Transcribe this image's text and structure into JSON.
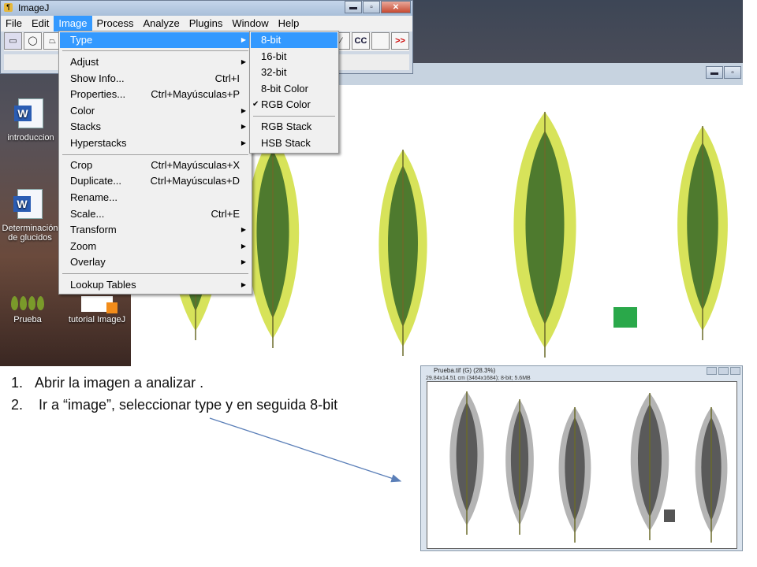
{
  "imagej": {
    "title": "ImageJ",
    "menubar": [
      "File",
      "Edit",
      "Image",
      "Process",
      "Analyze",
      "Plugins",
      "Window",
      "Help"
    ],
    "active_menu": "Image",
    "toolbar": {
      "cc_label": "CC",
      "more_label": ">>"
    }
  },
  "image_menu": {
    "items": [
      {
        "label": "Type",
        "shortcut": "",
        "submenu": true,
        "highlighted": true
      },
      {
        "label": "Adjust",
        "shortcut": "",
        "submenu": true
      },
      {
        "label": "Show Info...",
        "shortcut": "Ctrl+I"
      },
      {
        "label": "Properties...",
        "shortcut": "Ctrl+Mayúsculas+P"
      },
      {
        "label": "Color",
        "shortcut": "",
        "submenu": true
      },
      {
        "label": "Stacks",
        "shortcut": "",
        "submenu": true
      },
      {
        "label": "Hyperstacks",
        "shortcut": "",
        "submenu": true
      },
      {
        "label": "Crop",
        "shortcut": "Ctrl+Mayúsculas+X"
      },
      {
        "label": "Duplicate...",
        "shortcut": "Ctrl+Mayúsculas+D"
      },
      {
        "label": "Rename...",
        "shortcut": ""
      },
      {
        "label": "Scale...",
        "shortcut": "Ctrl+E"
      },
      {
        "label": "Transform",
        "shortcut": "",
        "submenu": true
      },
      {
        "label": "Zoom",
        "shortcut": "",
        "submenu": true
      },
      {
        "label": "Overlay",
        "shortcut": "",
        "submenu": true
      },
      {
        "label": "Lookup Tables",
        "shortcut": "",
        "submenu": true
      }
    ]
  },
  "type_submenu": {
    "items": [
      {
        "label": "8-bit",
        "highlighted": true
      },
      {
        "label": "16-bit"
      },
      {
        "label": "32-bit"
      },
      {
        "label": "8-bit Color"
      },
      {
        "label": "RGB Color",
        "checked": true
      },
      {
        "label": "RGB Stack"
      },
      {
        "label": "HSB Stack"
      }
    ]
  },
  "desktop_icons": [
    "introduccion",
    "Determinación de glucidos",
    "Prueba",
    "tutorial ImageJ"
  ],
  "instructions": [
    {
      "num": "1.",
      "text": "Abrir la imagen a analizar ."
    },
    {
      "num": "2.",
      "text": " Ir a “image”, seleccionar type y en seguida 8-bit"
    }
  ],
  "gray_window": {
    "title": "Prueba.tif (G) (28.3%)",
    "info": "29.84x14.51 cm (3464x1684); 8-bit; 5.6MB"
  },
  "colors": {
    "highlight": "#3399ff",
    "leaf_dark": "#4e7a2e",
    "leaf_light": "#d7e35a",
    "marker_green": "#2aa84a",
    "arrow": "#5b7fb8"
  }
}
